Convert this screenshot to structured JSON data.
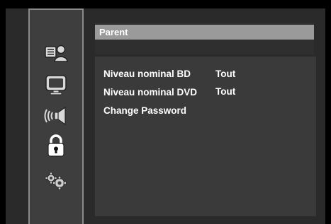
{
  "menu": {
    "title": "Parent",
    "items": [
      {
        "label": "Niveau nominal BD",
        "value": "Tout"
      },
      {
        "label": "Niveau nominal DVD",
        "value": "Tout"
      },
      {
        "label": "Change Password",
        "value": ""
      }
    ]
  },
  "sidebar": {
    "icons": [
      "language-icon",
      "display-icon",
      "audio-icon",
      "parental-lock-icon",
      "settings-icon"
    ],
    "selected": "parental-lock-icon"
  }
}
